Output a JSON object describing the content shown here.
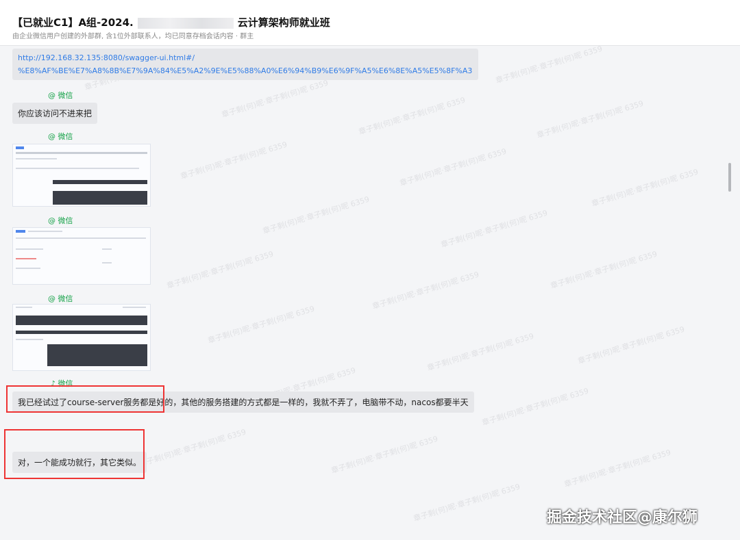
{
  "header": {
    "title_left": "【已就业C1】A组-2024.",
    "title_right": "云计算架构师就业班",
    "subtitle": "由企业微信用户创建的外部群, 含1位外部联系人，均已同意存档会话内容 · 群主"
  },
  "messages": {
    "link_line1": "http://192.168.32.135:8080/swagger-ui.html#/",
    "link_line2": "%E8%AF%BE%E7%A8%8B%E7%9A%84%E5%A2%9E%E5%88%A0%E6%94%B9%E6%9F%A5%E6%8E%A5%E5%8F%A3",
    "sender_1": "@ 微信",
    "text_1": "你应该访问不进来把",
    "sender_2": "@ 微信",
    "sender_3": "@ 微信",
    "sender_4": "@ 微信",
    "sender_5": "♪ 微信",
    "text_2": "我已经试过了course-server服务都是好的，其他的服务搭建的方式都是一样的，我就不弄了，电脑带不动，nacos都要半天",
    "text_3": "对，一个能成功就行，其它类似。"
  },
  "watermark": {
    "repeat_text": "章子剩(何)昵·章子剩(何)昵 6359",
    "brand": "掘金技术社区@康尔狮"
  },
  "colors": {
    "link": "#2f7be6",
    "sender": "#18a34a",
    "highlight": "#e33333",
    "bubble": "#e6e7ea"
  }
}
